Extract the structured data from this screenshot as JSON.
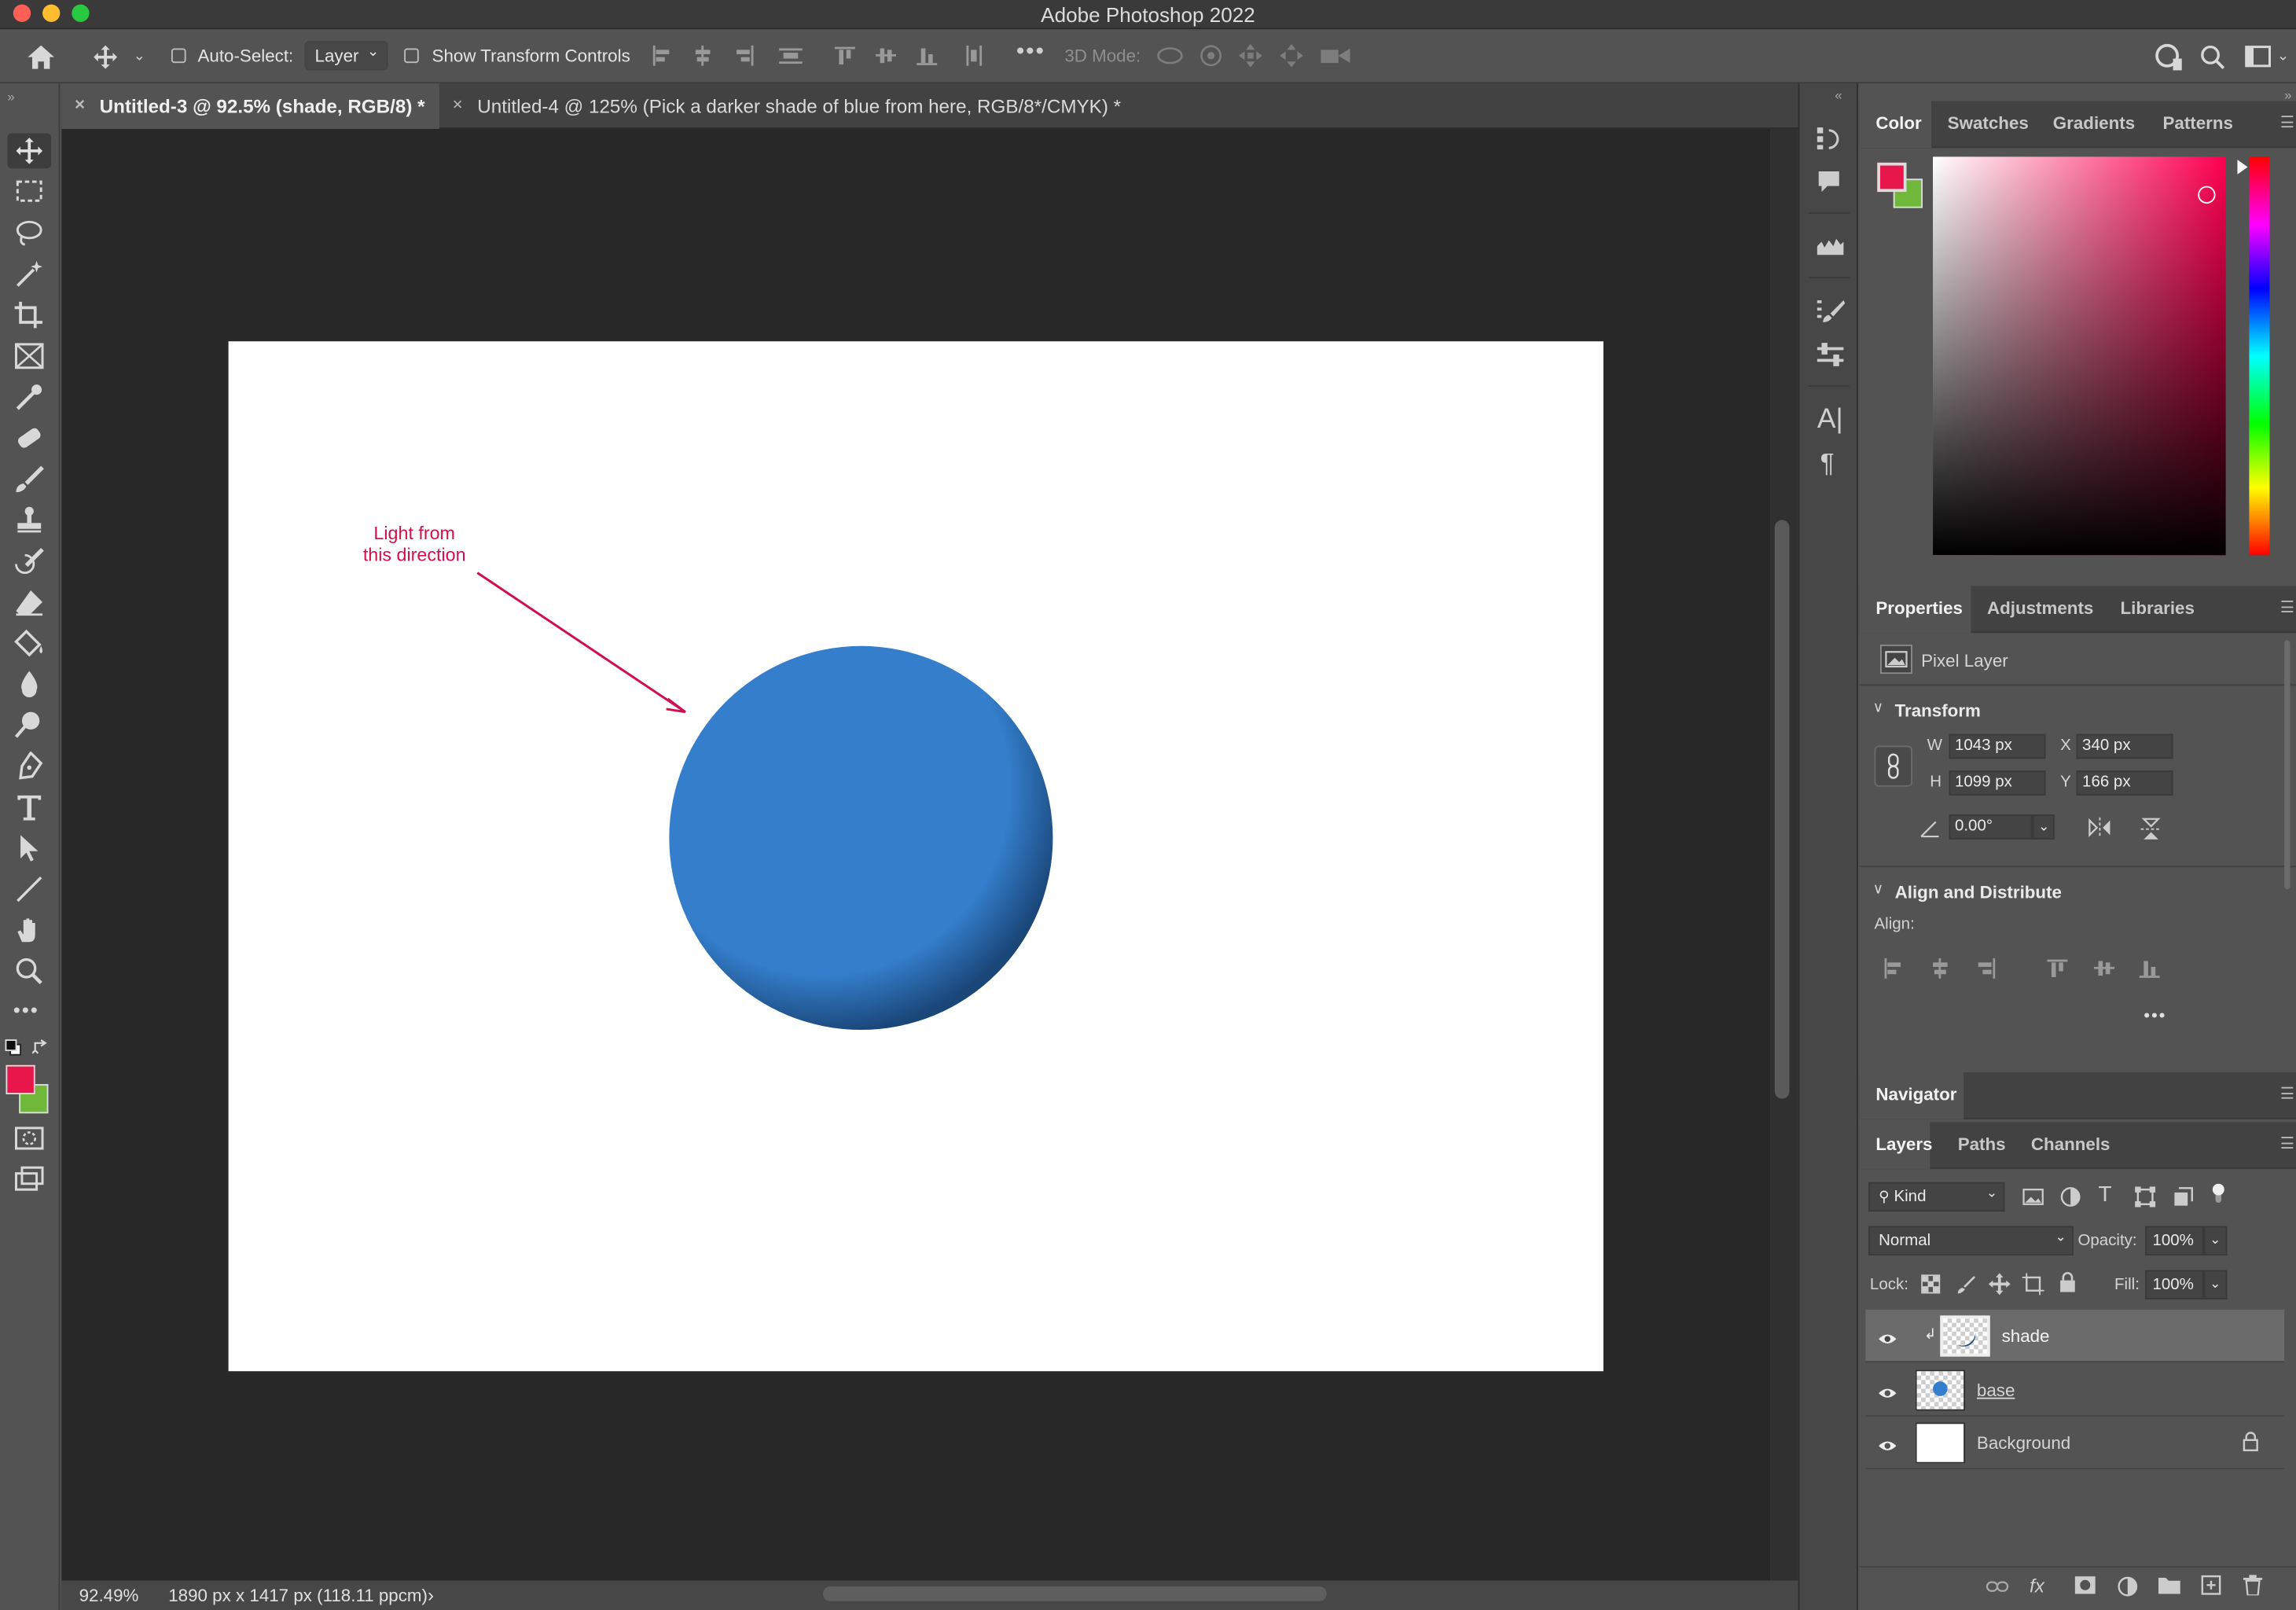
{
  "window": {
    "title": "Adobe Photoshop 2022"
  },
  "options_bar": {
    "auto_select_label": "Auto-Select:",
    "auto_select_value": "Layer",
    "show_transform_label": "Show Transform Controls",
    "mode_3d_label": "3D Mode:"
  },
  "tabs": [
    {
      "label": "Untitled-3 @ 92.5% (shade, RGB/8) *",
      "active": true
    },
    {
      "label": "Untitled-4 @ 125% (Pick a darker shade  of blue from here, RGB/8*/CMYK) *",
      "active": false
    }
  ],
  "canvas": {
    "annotation_line1": "Light from",
    "annotation_line2": "this direction",
    "annotation_color": "#d0104c",
    "sphere_color": "#347ecb",
    "sphere_shadow_color": "#1a4678"
  },
  "status": {
    "zoom": "92.49%",
    "doc_size": "1890 px x 1417 px (118.11 ppcm)"
  },
  "color_panel": {
    "tabs": [
      "Color",
      "Swatches",
      "Gradients",
      "Patterns"
    ],
    "foreground": "#e8174b",
    "background": "#6fb83a",
    "hue_color": "#ff0050"
  },
  "properties_panel": {
    "tabs": [
      "Properties",
      "Adjustments",
      "Libraries"
    ],
    "layer_type": "Pixel Layer",
    "transform_title": "Transform",
    "w_label": "W",
    "w_value": "1043 px",
    "x_label": "X",
    "x_value": "340 px",
    "h_label": "H",
    "h_value": "1099 px",
    "y_label": "Y",
    "y_value": "166 px",
    "angle_value": "0.00°",
    "align_title": "Align and Distribute",
    "align_label": "Align:"
  },
  "navigator": {
    "title": "Navigator"
  },
  "layers_panel": {
    "tabs": [
      "Layers",
      "Paths",
      "Channels"
    ],
    "filter_kind": "Kind",
    "blend_mode": "Normal",
    "opacity_label": "Opacity:",
    "opacity_value": "100%",
    "lock_label": "Lock:",
    "fill_label": "Fill:",
    "fill_value": "100%",
    "layers": [
      {
        "name": "shade",
        "selected": true
      },
      {
        "name": "base",
        "selected": false
      },
      {
        "name": "Background",
        "selected": false,
        "locked": true
      }
    ]
  }
}
